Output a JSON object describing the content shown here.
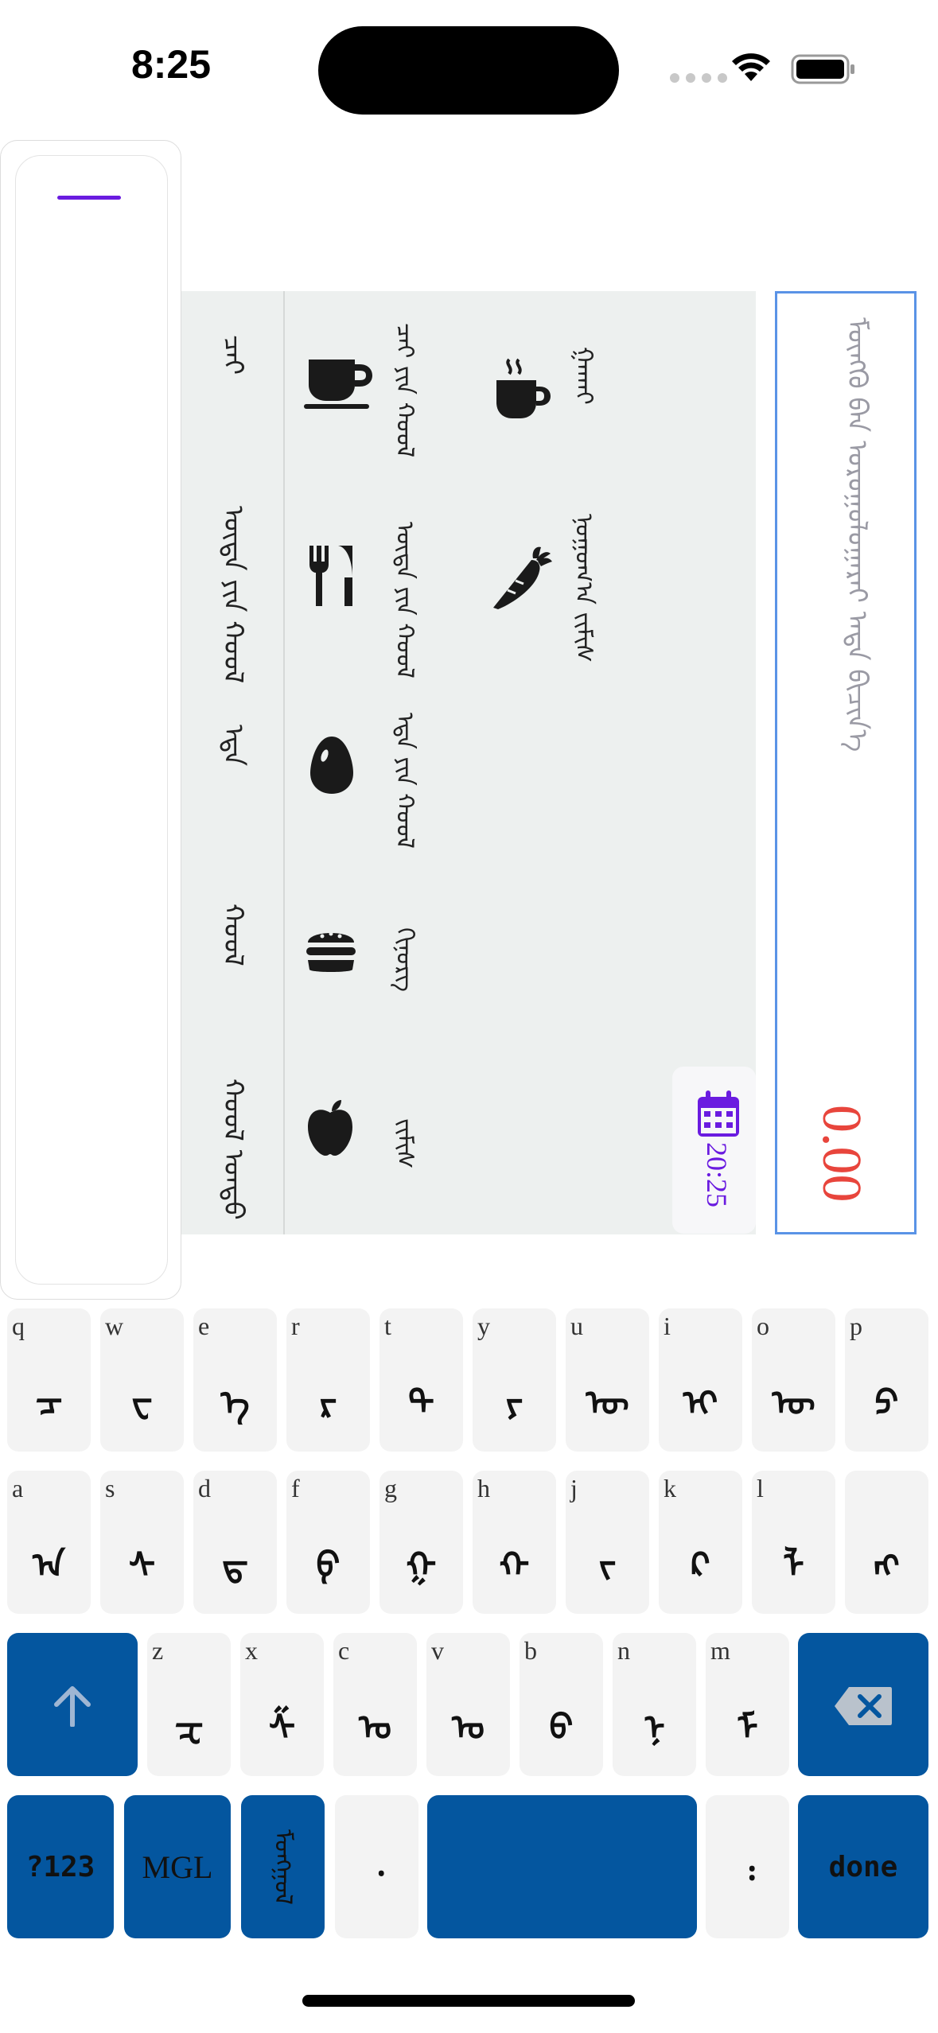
{
  "status": {
    "time": "8:25"
  },
  "categories": [
    {
      "label": "ᠬᠣᠣᠯ ᠤᠨᠳᠤ",
      "name": "ᠵᠢᠮᠢᠰ",
      "icon": "apple-icon"
    },
    {
      "label": "ᠬᠣᠣᠯ",
      "name": "ᠬᠢᠨ᠋ᠤᠷᠭ",
      "icon": "burger-icon"
    },
    {
      "label": "ᠡᠳᠡ",
      "name": "ᠡᠳᠡ ᠶᠢᠨ ᠬᠣᠣᠯ",
      "icon": "egg-icon"
    },
    {
      "label": "ᠦᠳᠡ ᠶᠢᠨ ᠬᠣᠣᠯ",
      "name": "ᠦᠳᠡ ᠶᠢᠨ ᠬᠣᠣᠯ",
      "icon": "fork-knife-icon"
    },
    {
      "label": "ᠴᠠᠢ",
      "name": "ᠴᠠᠢ ᠶᠢᠨ ᠬᠣᠣᠯ",
      "icon": "cup-saucer-icon"
    }
  ],
  "subcategories": [
    {
      "name": "ᠨᠣᠭᠣᠭ᠎ᠠ ᠵᠢᠮᠢᠰ",
      "icon": "carrot-icon"
    },
    {
      "name": "ᠭᠠᠬᠠᠢ",
      "icon": "hot-drink-icon"
    }
  ],
  "date": {
    "value": "20:25"
  },
  "amount": {
    "placeholder": "ᠮᠥᠩᠭᠦ ᠪᠠᠨ ᠣᠷᠣᠭᠤᠯᠤᠭᠠᠷᠠᠢ ᠡᠨᠳᠡ ᠪᠢᠴᠢᠨ᠎ᠡ",
    "value": "0.00"
  },
  "keyboard": {
    "row1": [
      {
        "latin": "q",
        "glyph": "ᠴ"
      },
      {
        "latin": "w",
        "glyph": "ᠸ"
      },
      {
        "latin": "e",
        "glyph": "ᠡ"
      },
      {
        "latin": "r",
        "glyph": "ᠷ"
      },
      {
        "latin": "t",
        "glyph": "ᠲ"
      },
      {
        "latin": "y",
        "glyph": "ᠶ"
      },
      {
        "latin": "u",
        "glyph": "ᠦ"
      },
      {
        "latin": "i",
        "glyph": "ᠢ"
      },
      {
        "latin": "o",
        "glyph": "ᠥ"
      },
      {
        "latin": "p",
        "glyph": "ᠫ"
      }
    ],
    "row2": [
      {
        "latin": "a",
        "glyph": "ᠠ"
      },
      {
        "latin": "s",
        "glyph": "ᠰ"
      },
      {
        "latin": "d",
        "glyph": "ᠳ"
      },
      {
        "latin": "f",
        "glyph": "ᠹ"
      },
      {
        "latin": "g",
        "glyph": "ᠭ"
      },
      {
        "latin": "h",
        "glyph": "ᠬ"
      },
      {
        "latin": "j",
        "glyph": "ᠵ"
      },
      {
        "latin": "k",
        "glyph": "ᠺ"
      },
      {
        "latin": "l",
        "glyph": "ᠯ"
      },
      {
        "latin": "",
        "glyph": "ᠩ"
      }
    ],
    "row3": [
      {
        "latin": "z",
        "glyph": "ᠽ"
      },
      {
        "latin": "x",
        "glyph": "ᠱ"
      },
      {
        "latin": "c",
        "glyph": "ᠣ"
      },
      {
        "latin": "v",
        "glyph": "ᠤ"
      },
      {
        "latin": "b",
        "glyph": "ᠪ"
      },
      {
        "latin": "n",
        "glyph": "ᠨ"
      },
      {
        "latin": "m",
        "glyph": "ᠮ"
      }
    ],
    "shift_icon": "shift-arrow-icon",
    "backspace_icon": "backspace-icon",
    "numbers_label": "?123",
    "mgl_label": "MGL",
    "script_label": "ᠮᠣᠩᠭᠣᠯ",
    "punct1": "᠂",
    "punct2": "᠄",
    "done_label": "done"
  }
}
